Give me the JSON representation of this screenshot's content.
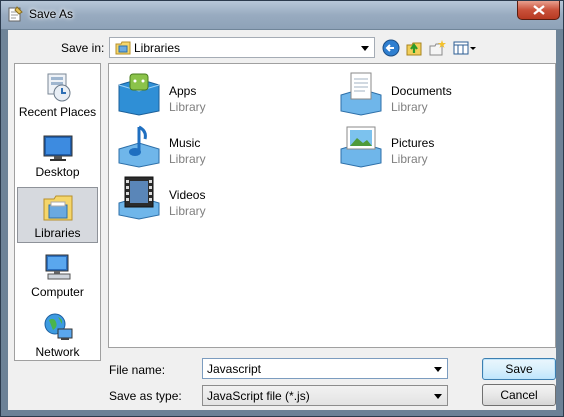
{
  "window": {
    "title": "Save As"
  },
  "toolbar": {
    "save_in_label": "Save in:",
    "save_in_value": "Libraries",
    "icons": [
      "back-icon",
      "up-folder-icon",
      "new-folder-icon",
      "views-menu-icon"
    ]
  },
  "places": [
    {
      "label": "Recent Places",
      "icon": "recent-places-icon",
      "selected": false
    },
    {
      "label": "Desktop",
      "icon": "desktop-icon",
      "selected": false
    },
    {
      "label": "Libraries",
      "icon": "libraries-icon",
      "selected": true
    },
    {
      "label": "Computer",
      "icon": "computer-icon",
      "selected": false
    },
    {
      "label": "Network",
      "icon": "network-icon",
      "selected": false
    }
  ],
  "libraries": [
    {
      "name": "Apps",
      "type": "Library",
      "icon": "apps-library-icon"
    },
    {
      "name": "Documents",
      "type": "Library",
      "icon": "documents-library-icon"
    },
    {
      "name": "Music",
      "type": "Library",
      "icon": "music-library-icon"
    },
    {
      "name": "Pictures",
      "type": "Library",
      "icon": "pictures-library-icon"
    },
    {
      "name": "Videos",
      "type": "Library",
      "icon": "videos-library-icon"
    }
  ],
  "form": {
    "file_name_label": "File name:",
    "file_name_value": "Javascript",
    "save_as_type_label": "Save as type:",
    "save_as_type_value": "JavaScript file (*.js)"
  },
  "buttons": {
    "save": "Save",
    "cancel": "Cancel"
  },
  "colors": {
    "selection": "#d6d9de",
    "default_button_border": "#3c7fb1"
  }
}
